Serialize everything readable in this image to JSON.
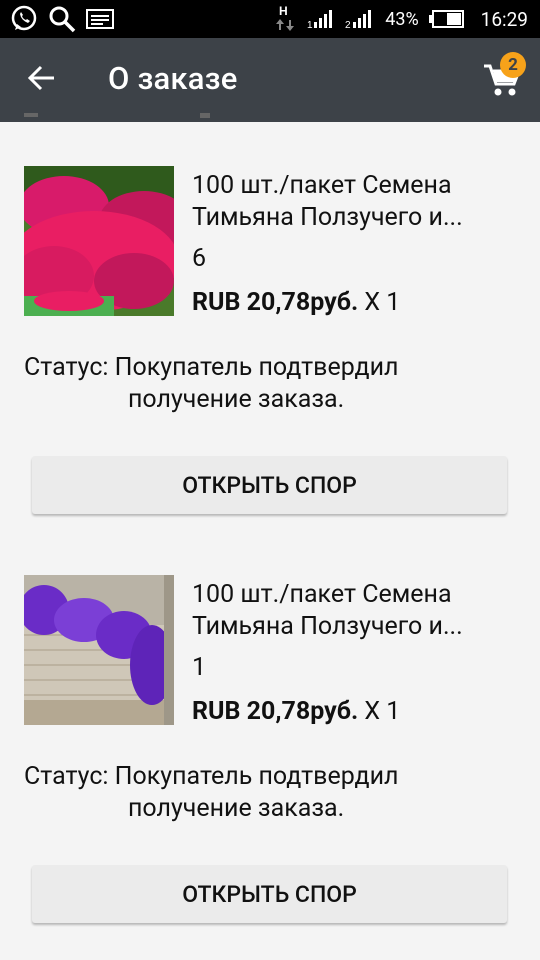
{
  "statusbar": {
    "battery": "43%",
    "time": "16:29"
  },
  "appbar": {
    "title": "О заказе",
    "cart_count": "2"
  },
  "items": [
    {
      "name_line1": "100 шт./пакет Семена",
      "name_line2": "Тимьяна Ползучего и...",
      "qty_mark": "6",
      "price": "RUB 20,78руб.",
      "multiplier": " X 1",
      "status_label": "Статус:",
      "status_line1": " Покупатель подтвердил",
      "status_line2": "получение заказа.",
      "button": "ОТКРЫТЬ СПОР"
    },
    {
      "name_line1": "100 шт./пакет Семена",
      "name_line2": "Тимьяна Ползучего и...",
      "qty_mark": "1",
      "price": "RUB 20,78руб.",
      "multiplier": " X 1",
      "status_label": "Статус:",
      "status_line1": " Покупатель подтвердил",
      "status_line2": "получение заказа.",
      "button": "ОТКРЫТЬ СПОР"
    }
  ]
}
